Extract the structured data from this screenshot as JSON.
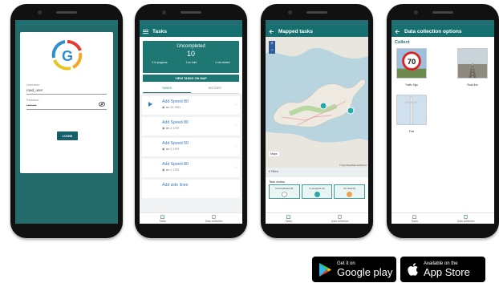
{
  "phone1": {
    "username_label": "Username",
    "username_value": "road_user",
    "password_label": "Password",
    "password_value": "••••••••",
    "login_button": "LOGIN"
  },
  "phone2": {
    "title": "Tasks",
    "summary": {
      "label": "Uncompleted",
      "count": "10",
      "in_progress": "6 in progress",
      "on_hold": "3 on hold",
      "not_started": "1 not started"
    },
    "view_map_button": "VIEW TASKS ON MAP",
    "tabs": [
      "TASKS",
      "HISTORY"
    ],
    "tasks": [
      {
        "name": "Add Speed 80",
        "date": "Jan 20, 2021",
        "active": true
      },
      {
        "name": "Add Speed 80",
        "date": "Jan 2, 1970",
        "active": false
      },
      {
        "name": "Add Speed 50",
        "date": "Jan 2, 1970",
        "active": false
      },
      {
        "name": "Add Speed 80",
        "date": "Jan 2, 1970",
        "active": false
      },
      {
        "name": "Add side lines",
        "date": "",
        "active": false
      }
    ],
    "footer": [
      "Tasks",
      "Data collection"
    ]
  },
  "phone3": {
    "title": "Mapped tasks",
    "zoom_in": "+",
    "zoom_out": "−",
    "maps_button": "Maps",
    "credit": "© OpenStreetMap contributors",
    "filters_label": "Filters",
    "task_status_label": "Task status",
    "statuses": [
      {
        "label": "Uncompleted (0)",
        "color": "#ffffff"
      },
      {
        "label": "In progress (2)",
        "color": "#27a9a9"
      },
      {
        "label": "On hold (0)",
        "color": "#f0a050"
      }
    ],
    "footer": [
      "Tasks",
      "Data collection"
    ]
  },
  "phone4": {
    "title": "Data collection options",
    "collect": "Collect",
    "options": [
      {
        "label": "Traffic Sign",
        "sign_text": "70"
      },
      {
        "label": "Road link"
      },
      {
        "label": "Pole"
      }
    ],
    "footer": [
      "Tasks",
      "Data collection"
    ]
  },
  "badges": {
    "google": {
      "line1": "Get it on",
      "line2": "Google play"
    },
    "apple": {
      "line1": "Available on the",
      "line2": "App Store"
    }
  },
  "colors": {
    "header": "#16706f",
    "accent": "#1f7774",
    "link": "#3a77c1"
  }
}
